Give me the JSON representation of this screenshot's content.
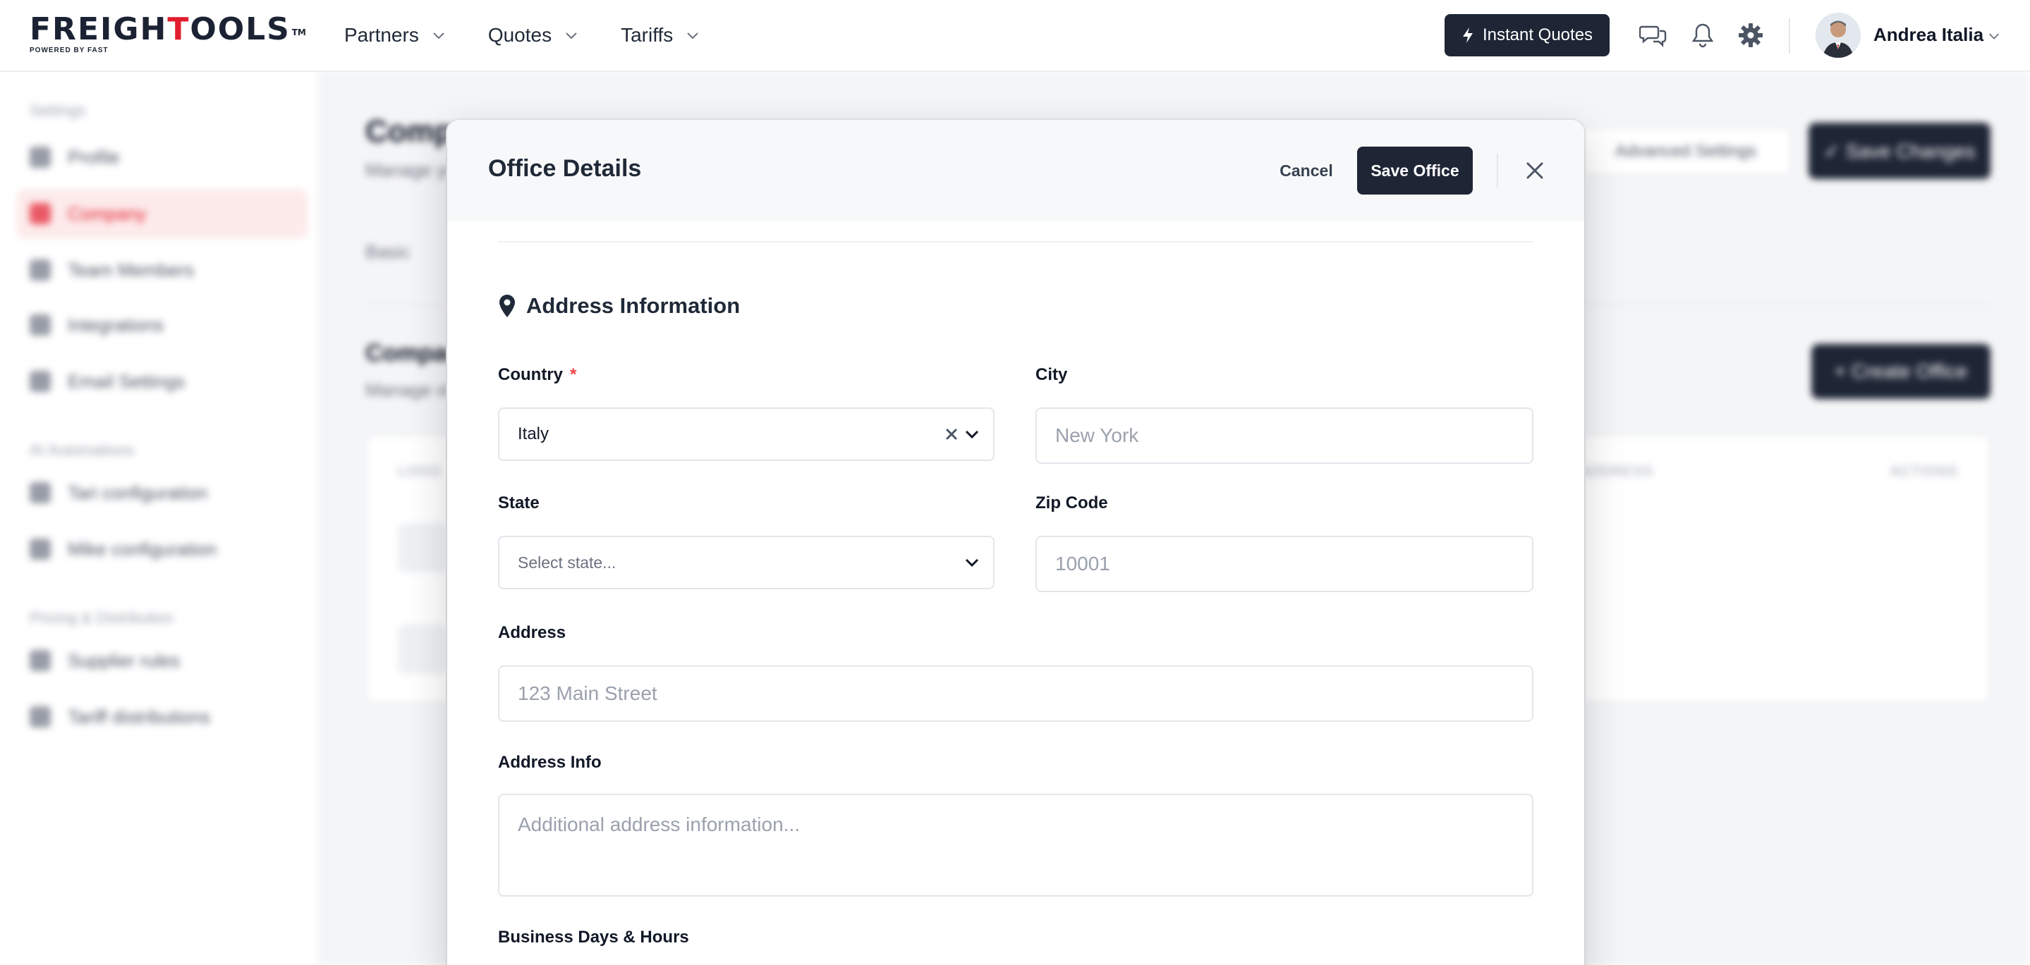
{
  "brand": {
    "logo_part1": "FREIGH",
    "logo_part2": "T",
    "logo_part3": "OOLS",
    "logo_tm": "TM",
    "logo_tagline": "POWERED BY FAST",
    "accent": "#e11d2e",
    "dark": "#1e2535"
  },
  "nav": {
    "items": [
      {
        "label": "Partners"
      },
      {
        "label": "Quotes"
      },
      {
        "label": "Tariffs"
      }
    ],
    "instant_quotes": "Instant Quotes",
    "icons": [
      "chat-icon",
      "bell-icon",
      "gear-icon"
    ],
    "user_name": "Andrea Italia"
  },
  "background": {
    "sidebar": {
      "sections": [
        "Settings",
        "AI Automations",
        "Pricing & Distribution"
      ],
      "items": [
        {
          "label": "Profile"
        },
        {
          "label": "Company"
        },
        {
          "label": "Team Members"
        },
        {
          "label": "Integrations"
        },
        {
          "label": "Email Settings"
        },
        {
          "label": "Tari configuration"
        },
        {
          "label": "Mike configuration"
        },
        {
          "label": "Supplier rules"
        },
        {
          "label": "Tariff distributions"
        }
      ]
    },
    "page_title": "Company",
    "page_subtitle": "Manage your company",
    "advanced_settings": "Advanced Settings",
    "save_changes": "✓ Save Changes",
    "tab": "Basic",
    "offices_title": "Company Offices",
    "offices_subtitle": "Manage offices",
    "create_office": "+ Create Office",
    "table_headers": [
      "LOGO",
      "ADDRESS",
      "ACTIONS"
    ]
  },
  "modal": {
    "title": "Office Details",
    "cancel": "Cancel",
    "save": "Save Office",
    "section_title": "Address Information",
    "country": {
      "label": "Country",
      "required_mark": "*",
      "value": "Italy"
    },
    "city": {
      "label": "City",
      "placeholder": "New York"
    },
    "state": {
      "label": "State",
      "placeholder": "Select state..."
    },
    "zip": {
      "label": "Zip Code",
      "placeholder": "10001"
    },
    "address": {
      "label": "Address",
      "placeholder": "123 Main Street"
    },
    "address_info": {
      "label": "Address Info",
      "placeholder": "Additional address information..."
    },
    "business_hours_label": "Business Days & Hours"
  }
}
